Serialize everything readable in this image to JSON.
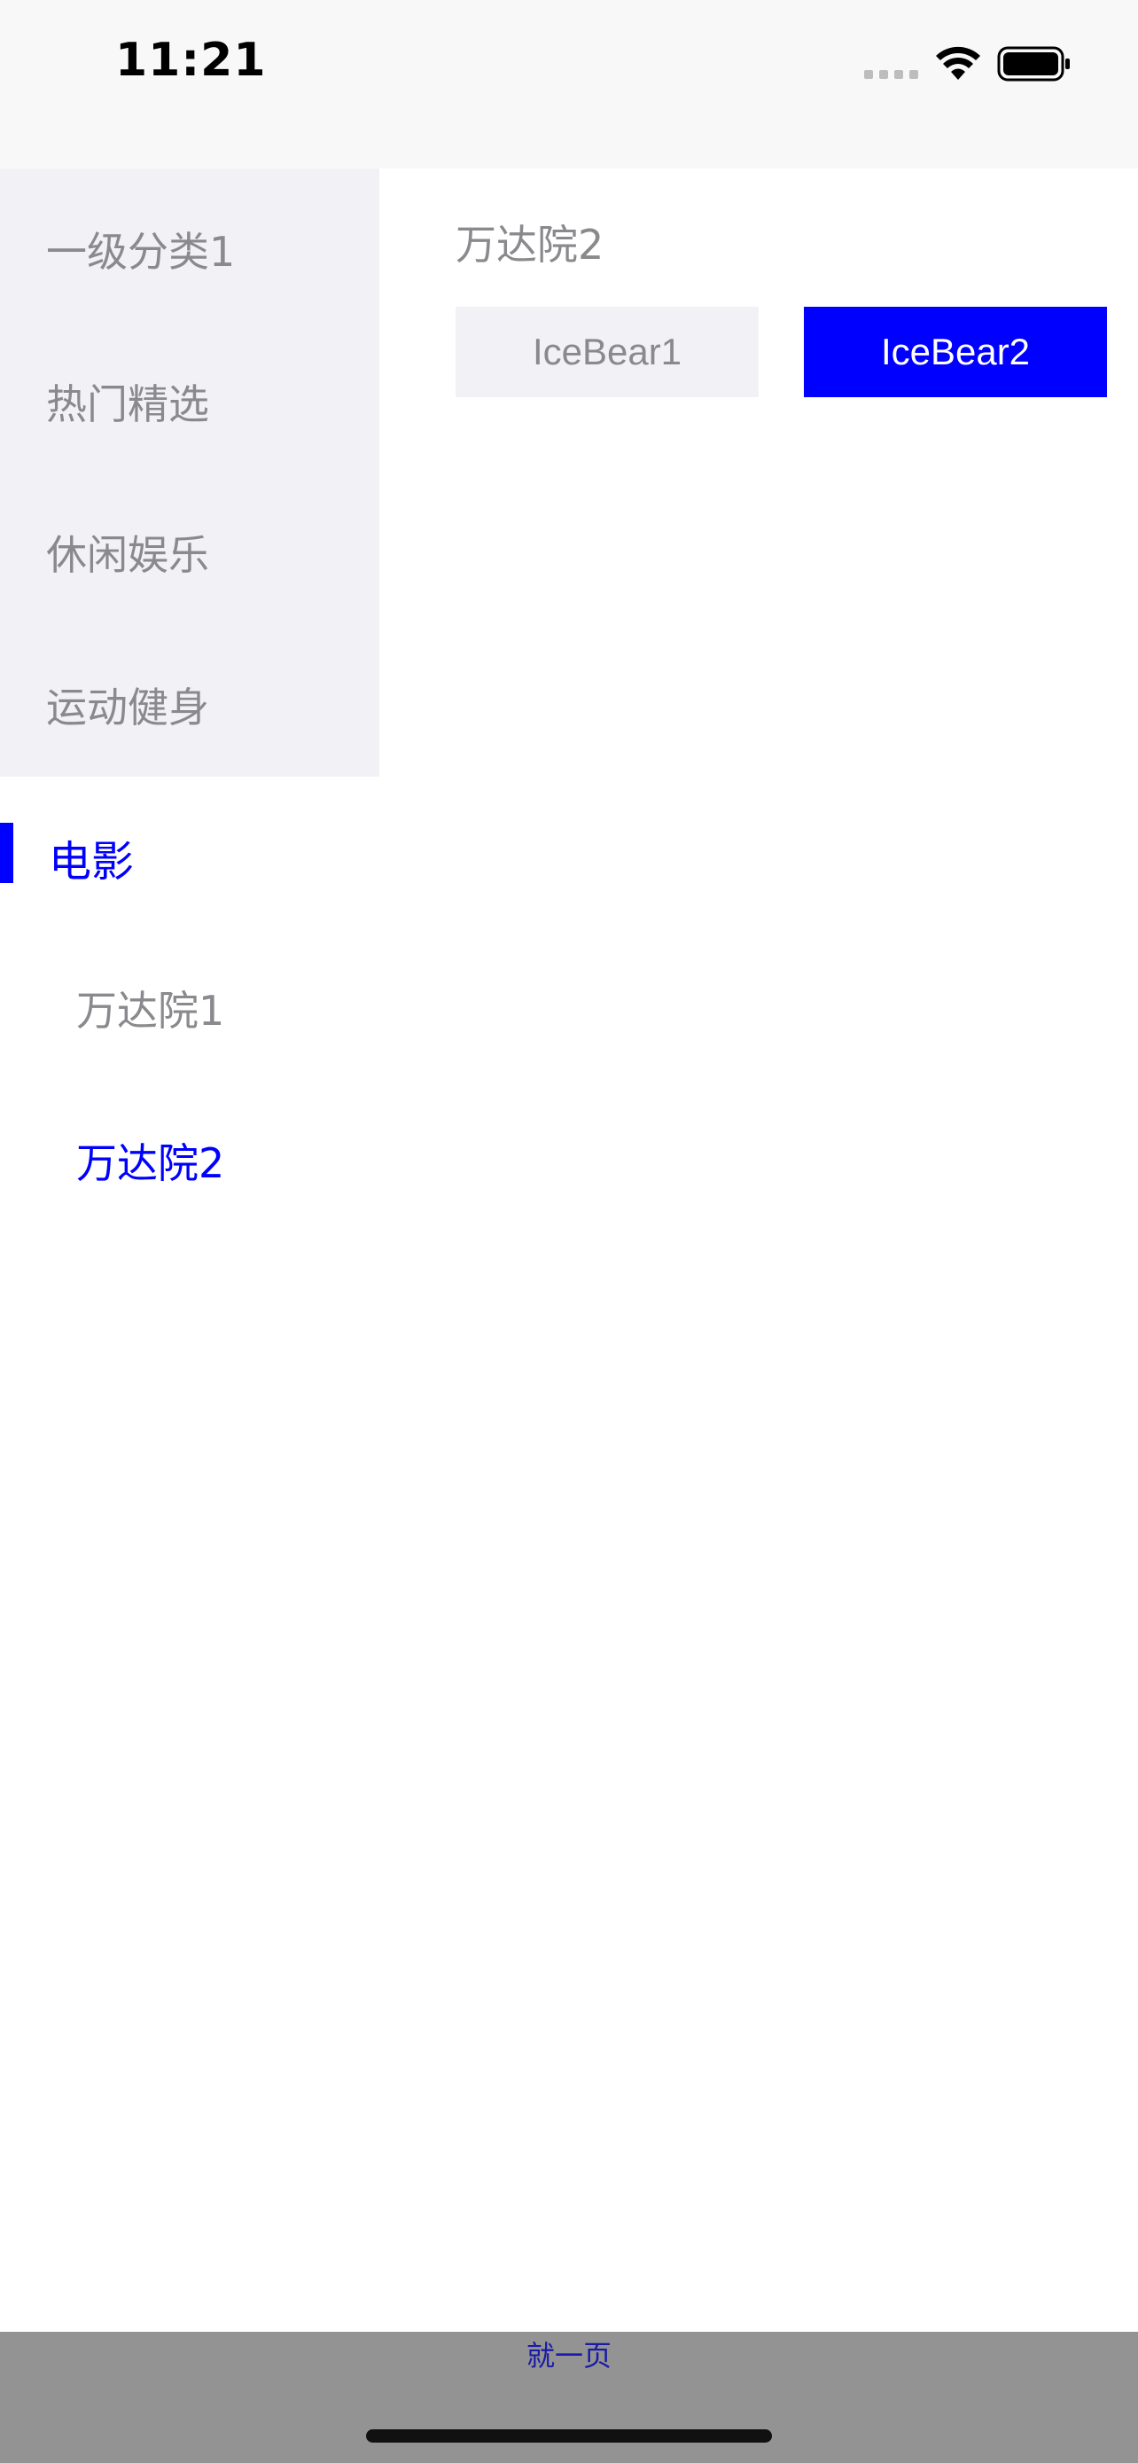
{
  "status_bar": {
    "time": "11:21"
  },
  "sidebar": {
    "items": [
      {
        "label": "一级分类1"
      },
      {
        "label": "热门精选"
      },
      {
        "label": "休闲娱乐"
      },
      {
        "label": "运动健身"
      }
    ],
    "selected": {
      "label": "电影"
    },
    "subitems": [
      {
        "label": "万达院1",
        "selected": false
      },
      {
        "label": "万达院2",
        "selected": true
      }
    ]
  },
  "content": {
    "section_title": "万达院2",
    "chips": [
      {
        "label": "IceBear1",
        "selected": false
      },
      {
        "label": "IceBear2",
        "selected": true
      }
    ]
  },
  "bottom_bar": {
    "label": "就一页"
  },
  "colors": {
    "accent": "#0000ff",
    "text_gray": "#8a8a8e",
    "sidebar_bg": "#f2f2f6",
    "bottom_bar_bg": "#939393"
  },
  "icons": {
    "signal": "signal-icon",
    "wifi": "wifi-icon",
    "battery": "battery-icon"
  }
}
